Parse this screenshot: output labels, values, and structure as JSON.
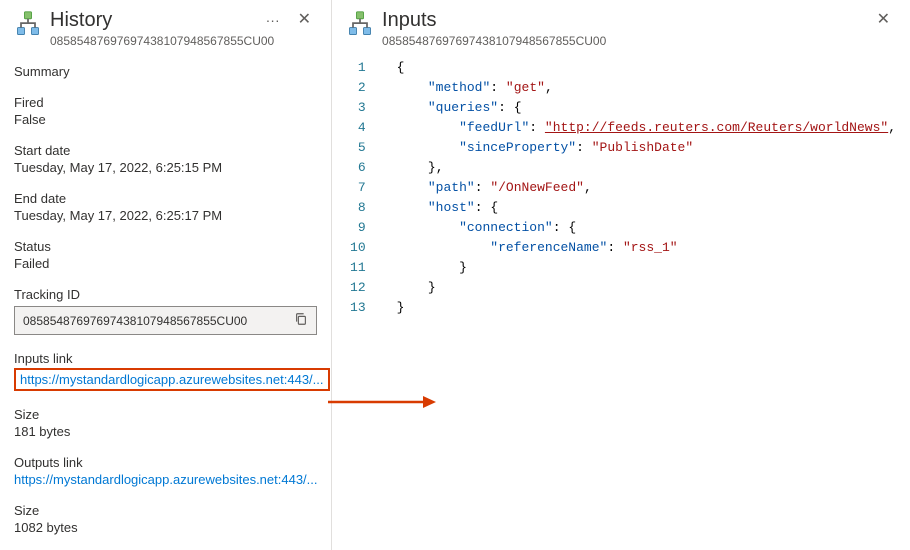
{
  "history": {
    "title": "History",
    "subtitle": "08585487697697438107948567855CU00",
    "summary_label": "Summary",
    "fired_label": "Fired",
    "fired_value": "False",
    "start_label": "Start date",
    "start_value": "Tuesday, May 17, 2022, 6:25:15 PM",
    "end_label": "End date",
    "end_value": "Tuesday, May 17, 2022, 6:25:17 PM",
    "status_label": "Status",
    "status_value": "Failed",
    "tracking_label": "Tracking ID",
    "tracking_value": "08585487697697438107948567855CU00",
    "inputs_link_label": "Inputs link",
    "inputs_link_value": "https://mystandardlogicapp.azurewebsites.net:443/...",
    "inputs_size_label": "Size",
    "inputs_size_value": "181 bytes",
    "outputs_link_label": "Outputs link",
    "outputs_link_value": "https://mystandardlogicapp.azurewebsites.net:443/...",
    "outputs_size_label": "Size",
    "outputs_size_value": "1082 bytes"
  },
  "inputs": {
    "title": "Inputs",
    "subtitle": "08585487697697438107948567855CU00",
    "json": {
      "method": "get",
      "queries": {
        "feedUrl": "http://feeds.reuters.com/Reuters/worldNews",
        "sinceProperty": "PublishDate"
      },
      "path": "/OnNewFeed",
      "host": {
        "connection": {
          "referenceName": "rss_1"
        }
      }
    },
    "lines": [
      "{",
      "    \"method\": \"get\",",
      "    \"queries\": {",
      "        \"feedUrl\": \"http://feeds.reuters.com/Reuters/worldNews\",",
      "        \"sinceProperty\": \"PublishDate\"",
      "    },",
      "    \"path\": \"/OnNewFeed\",",
      "    \"host\": {",
      "        \"connection\": {",
      "            \"referenceName\": \"rss_1\"",
      "        }",
      "    }",
      "}"
    ]
  },
  "colors": {
    "link": "#0078d4",
    "highlight": "#d83b01"
  }
}
